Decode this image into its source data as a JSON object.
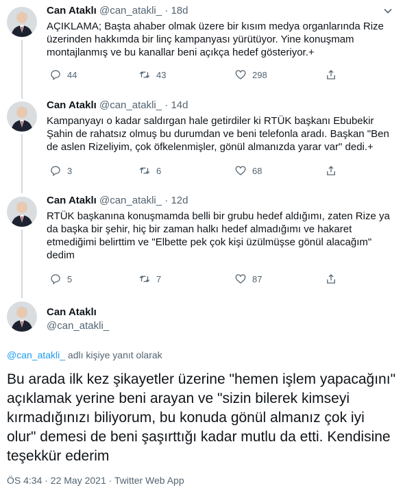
{
  "thread": [
    {
      "name": "Can Ataklı",
      "handle": "@can_atakli_",
      "separator": "·",
      "time": "18d",
      "text": "AÇIKLAMA; Başta ahaber olmak üzere bir kısım medya organlarında Rize üzerinden hakkımda bir linç kampanyası yürütüyor. Yine konuşmam montajlanmış ve bu kanallar beni açıkça hedef gösteriyor.+",
      "replies": "44",
      "retweets": "43",
      "likes": "298"
    },
    {
      "name": "Can Ataklı",
      "handle": "@can_atakli_",
      "separator": "·",
      "time": "14d",
      "text": "Kampanyayı o kadar saldırgan hale getirdiler ki RTÜK başkanı Ebubekir Şahin de rahatsız olmuş bu durumdan ve beni telefonla aradı. Başkan \"Ben de aslen Rizeliyim, çok öfkelenmişler, gönül almanızda yarar var\" dedi.+",
      "replies": "3",
      "retweets": "6",
      "likes": "68"
    },
    {
      "name": "Can Ataklı",
      "handle": "@can_atakli_",
      "separator": "·",
      "time": "12d",
      "text": "RTÜK başkanına konuşmamda belli bir grubu hedef aldığımı, zaten Rize ya da başka bir şehir, hiç bir zaman halkı hedef almadığımı ve hakaret etmediğimi belirttim ve \"Elbette pek çok kişi üzülmüşse gönül alacağım\" dedim",
      "replies": "5",
      "retweets": "7",
      "likes": "87"
    }
  ],
  "main_tweet": {
    "name": "Can Ataklı",
    "handle": "@can_atakli_",
    "reply_mention": "@can_atakli_",
    "reply_suffix": " adlı kişiye yanıt olarak",
    "text": "Bu arada ilk kez şikayetler üzerine \"hemen işlem yapacağını\" açıklamak yerine beni arayan ve \"sizin bilerek kimseyi kırmadığınızı biliyorum, bu konuda gönül almanız çok iyi olur\" demesi de beni şaşırttığı kadar mutlu da etti. Kendisine teşekkür ederim",
    "meta": "ÖS 4:34 · 22 May 2021 · Twitter Web App"
  },
  "icons": {
    "more": "more-icon",
    "reply": "reply-icon",
    "retweet": "retweet-icon",
    "like": "like-icon",
    "share": "share-icon"
  },
  "colors": {
    "text": "#0f1419",
    "secondary": "#536471",
    "link": "#1d9bf0",
    "thread_line": "#cfd9de"
  }
}
